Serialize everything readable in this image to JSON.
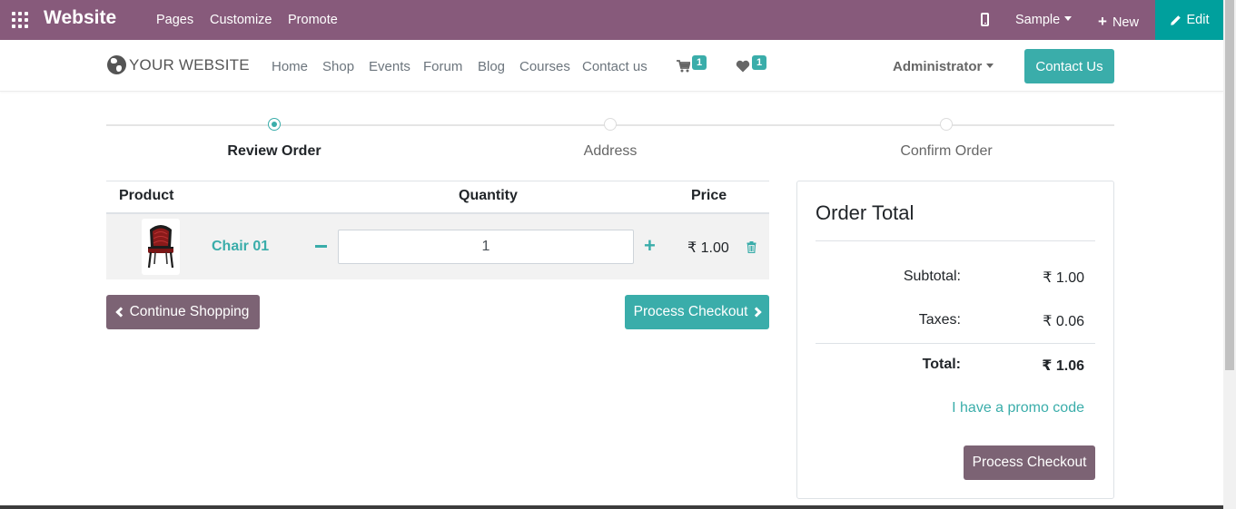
{
  "odoo_bar": {
    "app_title": "Website",
    "menu": [
      "Pages",
      "Customize",
      "Promote"
    ],
    "sample_label": "Sample",
    "new_label": "New",
    "edit_label": "Edit",
    "bg_color": "#875a7b",
    "edit_color": "#00a09d"
  },
  "site_header": {
    "logo_text": "YOUR WEBSITE",
    "nav": [
      "Home",
      "Shop",
      "Events",
      "Forum",
      "Blog",
      "Courses",
      "Contact us"
    ],
    "cart_count": "1",
    "wishlist_count": "1",
    "user_label": "Administrator",
    "contact_button": "Contact Us"
  },
  "wizard": {
    "steps": [
      "Review Order",
      "Address",
      "Confirm Order"
    ],
    "active_step": 0
  },
  "cart": {
    "headers": {
      "product": "Product",
      "quantity": "Quantity",
      "price": "Price"
    },
    "items": [
      {
        "name": "Chair 01",
        "quantity": "1",
        "price": "₹ 1.00"
      }
    ],
    "continue_label": "Continue Shopping",
    "checkout_label": "Process Checkout"
  },
  "order_total": {
    "title": "Order Total",
    "subtotal_label": "Subtotal:",
    "subtotal_value": "₹ 1.00",
    "taxes_label": "Taxes:",
    "taxes_value": "₹ 0.06",
    "total_label": "Total:",
    "total_value": "₹ 1.06",
    "promo_label": "I have a promo code",
    "checkout_label": "Process Checkout"
  },
  "colors": {
    "accent": "#3aadaa",
    "secondary": "#7c6374"
  }
}
